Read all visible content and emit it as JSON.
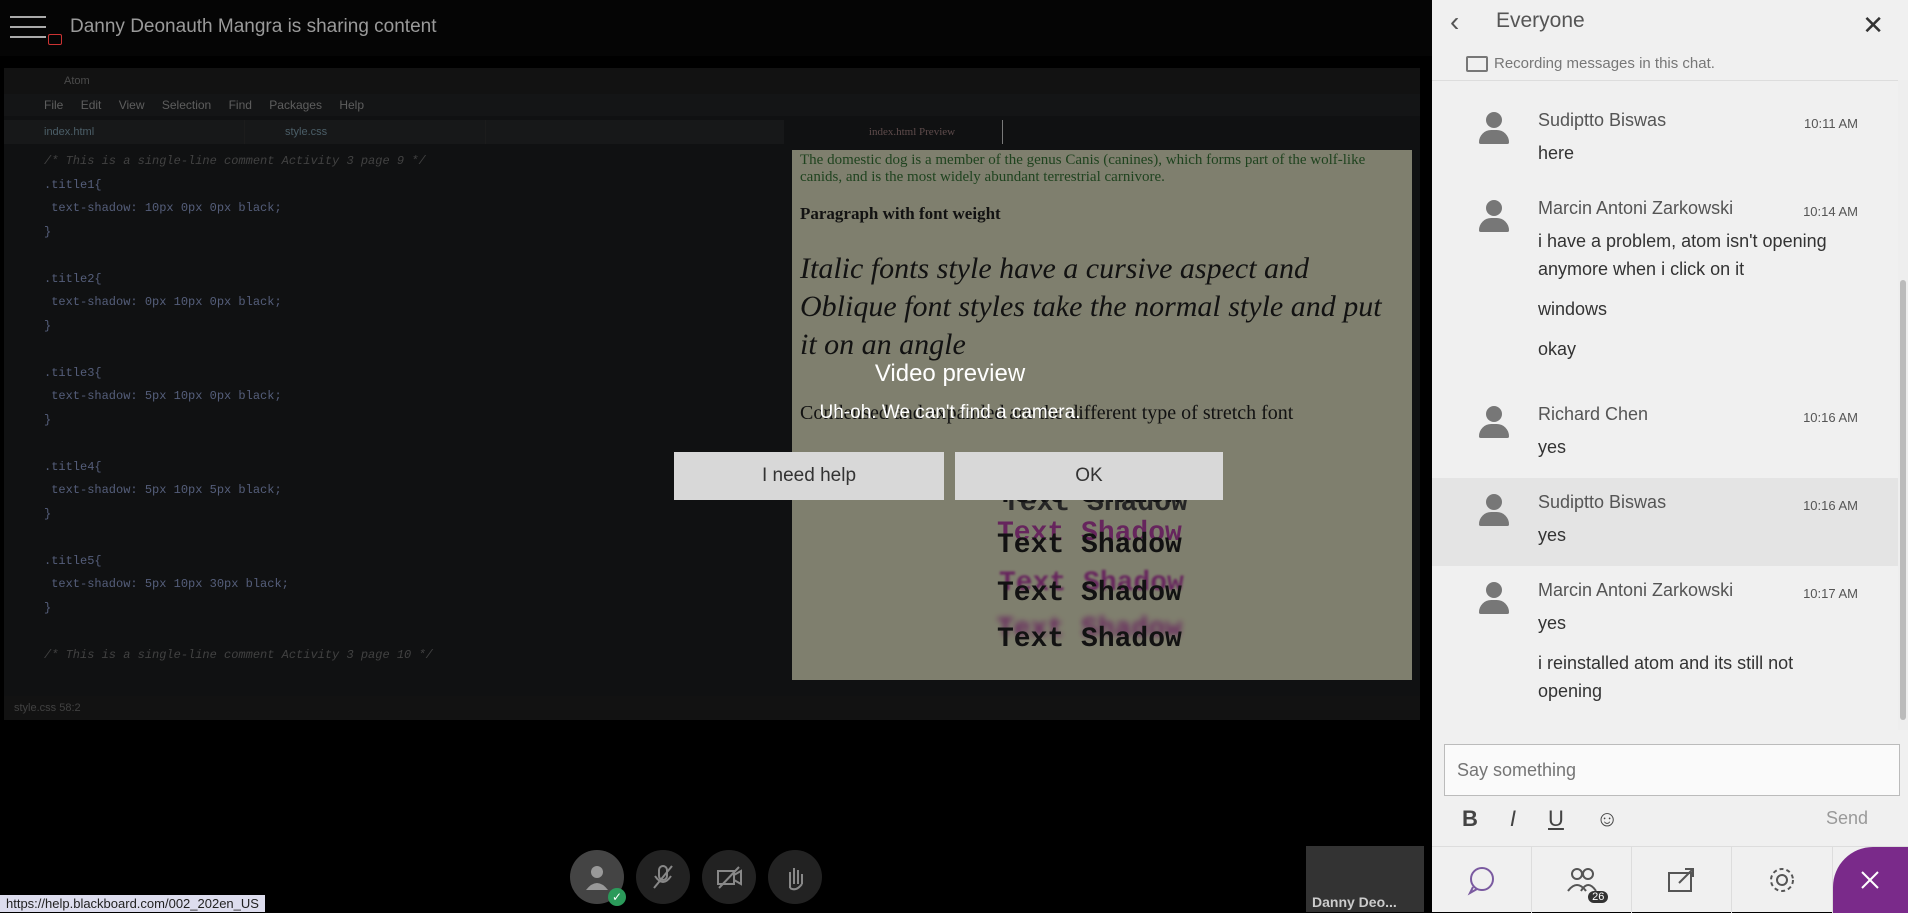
{
  "header": {
    "share_title": "Danny Deonauth Mangra is sharing content"
  },
  "shared_screen": {
    "menu": [
      "File",
      "Edit",
      "View",
      "Selection",
      "Find",
      "Packages",
      "Help"
    ],
    "tabs": [
      "index.html",
      "style.css"
    ],
    "preview_tab": "index.html Preview",
    "code_lines": [
      "/* This is a single-line comment Activity 3 page 9 */",
      ".title1{",
      " text-shadow: 10px 0px 0px black;",
      "}",
      "",
      ".title2{",
      " text-shadow: 0px 10px 0px black;",
      "}",
      "",
      ".title3{",
      " text-shadow: 5px 10px 0px black;",
      "}",
      "",
      ".title4{",
      " text-shadow: 5px 10px 5px black;",
      "}",
      "",
      ".title5{",
      " text-shadow: 5px 10px 30px black;",
      "}",
      "",
      "/* This is a single-line comment Activity 3 page 10 */"
    ],
    "preview": {
      "p1": "The domestic dog is a member of the genus Canis (canines), which forms part of the wolf-like canids, and is the most widely abundant terrestrial carnivore.",
      "p2": "Paragraph with font weight",
      "p3": "Italic fonts style have a cursive aspect and Oblique font styles take the normal style and put it on an angle",
      "p4": "Condensed and expanded are the different type of stretch font",
      "shadow_text": "Text Shadow"
    },
    "status": "style.css 58:2"
  },
  "dialog": {
    "title": "Video preview",
    "message": "Uh-oh. We can't find a camera.",
    "help_button": "I need help",
    "ok_button": "OK"
  },
  "status_url": "https://help.blackboard.com/002_202en_US",
  "thumbnail": {
    "name": "Danny Deo..."
  },
  "chat": {
    "title": "Everyone",
    "recording_note": "Recording messages in this chat.",
    "messages": [
      {
        "name": "Sudiptto Biswas",
        "time": "10:11 AM",
        "texts": [
          "here"
        ]
      },
      {
        "name": "Marcin Antoni Zarkowski",
        "time": "10:14 AM",
        "texts": [
          "i have a problem, atom isn't opening anymore when i click on it",
          "windows",
          "okay"
        ]
      },
      {
        "name": "Richard Chen",
        "time": "10:16 AM",
        "texts": [
          "yes"
        ]
      },
      {
        "name": "Sudiptto Biswas",
        "time": "10:16 AM",
        "texts": [
          "yes"
        ]
      },
      {
        "name": "Marcin Antoni Zarkowski",
        "time": "10:17 AM",
        "texts": [
          "yes",
          "i reinstalled atom and its still not opening"
        ]
      }
    ],
    "input_placeholder": "Say something",
    "send_label": "Send",
    "format": {
      "bold": "B",
      "italic": "I",
      "underline": "U"
    },
    "attendee_count": "26"
  }
}
